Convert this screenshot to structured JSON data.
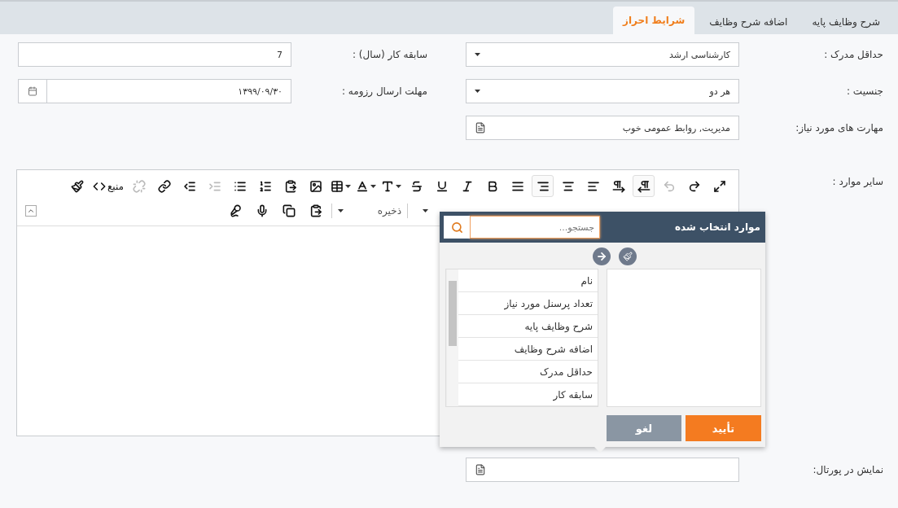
{
  "tabs": [
    {
      "label": "شرح وظایف پایه",
      "selected": false
    },
    {
      "label": "اضافه شرح وظایف",
      "selected": false
    },
    {
      "label": "شرایط احراز",
      "selected": true
    }
  ],
  "fields": [
    {
      "label": "حداقل مدرک :",
      "kind": "select",
      "value": "کارشناسی ارشد"
    },
    {
      "label": "سابقه کار (سال) :",
      "kind": "text",
      "value": "7"
    },
    {
      "label": "جنسیت :",
      "kind": "select",
      "value": "هر دو"
    },
    {
      "label": "مهلت ارسال رزومه :",
      "kind": "date",
      "value": "۱۳۹۹/۰۹/۳۰"
    },
    {
      "label": "مهارت های مورد نیاز:",
      "kind": "picker",
      "value": "مدیریت, روابط عمومی خوب"
    }
  ],
  "editor": {
    "label": "سایر موارد :",
    "toolbar": [
      {
        "kind": "maximize",
        "disabled": false,
        "selected": false,
        "dropdown": false
      },
      {
        "kind": "redo",
        "disabled": false,
        "selected": false,
        "dropdown": false
      },
      {
        "kind": "undo",
        "disabled": true,
        "selected": false,
        "dropdown": false
      },
      {
        "kind": "rtl",
        "disabled": false,
        "selected": true,
        "dropdown": false
      },
      {
        "kind": "ltr",
        "disabled": false,
        "selected": false,
        "dropdown": false
      },
      {
        "kind": "align_left",
        "disabled": false,
        "selected": false,
        "dropdown": false
      },
      {
        "kind": "align_center",
        "disabled": false,
        "selected": false,
        "dropdown": false
      },
      {
        "kind": "align_right",
        "disabled": false,
        "selected": true,
        "dropdown": false
      },
      {
        "kind": "justify",
        "disabled": false,
        "selected": false,
        "dropdown": false
      },
      {
        "kind": "bold",
        "disabled": false,
        "selected": false,
        "dropdown": false
      },
      {
        "kind": "italic",
        "disabled": false,
        "selected": false,
        "dropdown": false
      },
      {
        "kind": "underline",
        "disabled": false,
        "selected": false,
        "dropdown": false
      },
      {
        "kind": "strike",
        "disabled": false,
        "selected": false,
        "dropdown": false
      },
      {
        "kind": "font",
        "disabled": false,
        "selected": false,
        "dropdown": true
      },
      {
        "kind": "color",
        "disabled": false,
        "selected": false,
        "dropdown": true
      },
      {
        "kind": "table",
        "disabled": false,
        "selected": false,
        "dropdown": true
      },
      {
        "kind": "image",
        "disabled": false,
        "selected": false,
        "dropdown": false
      },
      {
        "kind": "paste",
        "disabled": false,
        "selected": false,
        "dropdown": false
      },
      {
        "kind": "ordered",
        "disabled": false,
        "selected": false,
        "dropdown": false
      },
      {
        "kind": "bullets",
        "disabled": false,
        "selected": false,
        "dropdown": false
      },
      {
        "kind": "indent",
        "disabled": true,
        "selected": false,
        "dropdown": false
      },
      {
        "kind": "outdent",
        "disabled": false,
        "selected": false,
        "dropdown": false
      },
      {
        "kind": "link",
        "disabled": false,
        "selected": false,
        "dropdown": false
      },
      {
        "kind": "unlink",
        "disabled": true,
        "selected": false,
        "dropdown": false
      },
      {
        "kind": "source",
        "label": "منبع",
        "disabled": false,
        "selected": false,
        "dropdown": false
      },
      {
        "kind": "clean",
        "disabled": false,
        "selected": false,
        "dropdown": false
      }
    ],
    "toolbar_2": [
      {
        "kind": "select"
      },
      {
        "kind": "select",
        "label": "ذخیره"
      },
      {
        "kind": "paste"
      },
      {
        "kind": "copy"
      },
      {
        "kind": "mic"
      },
      {
        "kind": "mic_settings"
      }
    ]
  },
  "popup": {
    "title": "موارد انتخاب شده",
    "search_placeholder": "جستجو...",
    "items": [
      "نام",
      "تعداد پرسنل مورد نیاز",
      "شرح وظایف پایه",
      "اضافه شرح وظایف",
      "حداقل مدرک",
      "سابقه کار"
    ],
    "confirm": "تأیید",
    "cancel": "لغو"
  },
  "portal": {
    "label": "نمایش در پورتال:"
  }
}
